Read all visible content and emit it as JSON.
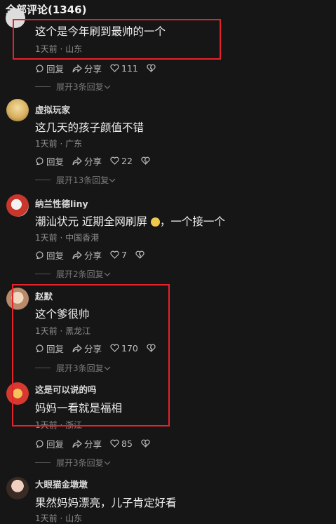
{
  "header": {
    "title": "全部评论(1346)"
  },
  "reply_label": "回复",
  "share_label": "分享",
  "comments": [
    {
      "user": "",
      "text": "这个是今年刷到最帅的一个",
      "time": "1天前",
      "location": "山东",
      "likes": "111",
      "expand": "展开3条回复"
    },
    {
      "user": "虚拟玩家",
      "text": "这几天的孩子颜值不错",
      "time": "1天前",
      "location": "广东",
      "likes": "22",
      "expand": "展开13条回复"
    },
    {
      "user": "纳兰性德liny",
      "text": "潮汕状元 近期全网刷屏",
      "text2": "，一个接一个",
      "time": "1天前",
      "location": "中国香港",
      "likes": "7",
      "expand": "展开2条回复"
    },
    {
      "user": "赵默",
      "text": "这个爹很帅",
      "time": "1天前",
      "location": "黑龙江",
      "likes": "170",
      "expand": "展开3条回复"
    },
    {
      "user": "这是可以说的吗",
      "text": "妈妈一看就是福相",
      "time": "1天前",
      "location": "浙江",
      "likes": "85",
      "expand": "展开3条回复"
    },
    {
      "user": "大眼猫金墩墩",
      "text": "果然妈妈漂亮，儿子肯定好看",
      "time": "1天前",
      "location": "山东"
    }
  ],
  "colors": {
    "background": "#161616",
    "highlight_box": "#e5232a",
    "meta_gray": "#8e8e8e"
  }
}
